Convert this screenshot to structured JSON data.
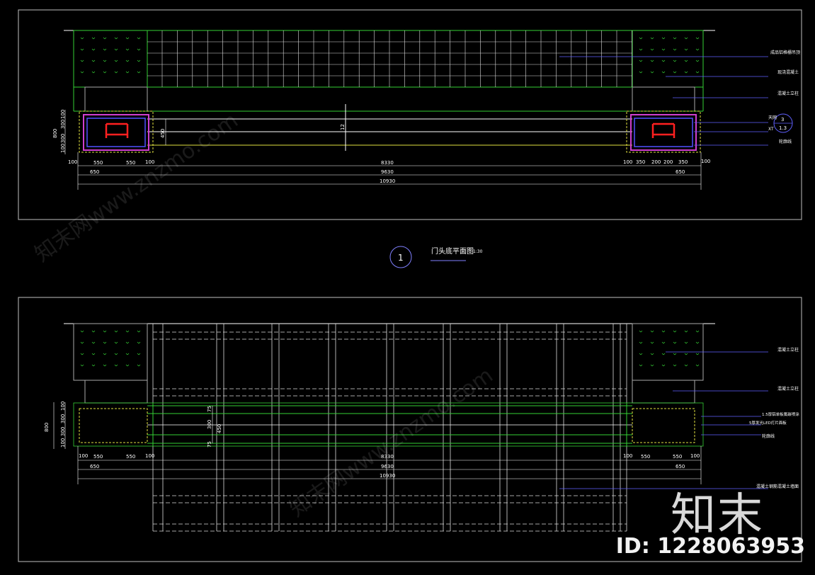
{
  "title": {
    "number": "1",
    "text": "门头底平面图",
    "scale": "1:30"
  },
  "top_plan": {
    "callouts": [
      "成品铝格栅吊顶",
      "现浇混凝土",
      "混凝土立柱",
      "天网",
      "XT",
      "轮廓线"
    ],
    "section_symbol": {
      "top": "3",
      "bottom": "1.3"
    },
    "dims_row1": [
      "100",
      "550",
      "550",
      "100",
      "8330",
      "100",
      "350",
      "200",
      "200",
      "350",
      "100"
    ],
    "dims_row2": [
      "650",
      "9630",
      "650"
    ],
    "dims_row3": [
      "10930"
    ],
    "vertical_dims": [
      "100",
      "300",
      "300",
      "100"
    ],
    "vertical_total": "800",
    "inner_dim": "450",
    "mid_label": "12"
  },
  "bottom_plan": {
    "callouts": [
      "混凝土立柱",
      "混凝土立柱",
      "1.5厚铝单板氟碳喷涂",
      "5厚发光LED灯片面板",
      "轮廓线",
      "混凝土钢筋混凝土墙面"
    ],
    "dims_row1": [
      "100",
      "550",
      "550",
      "100",
      "8330",
      "100",
      "550",
      "550",
      "100"
    ],
    "dims_row2": [
      "650",
      "9630",
      "650"
    ],
    "dims_row3": [
      "10930"
    ],
    "vertical_dims": [
      "100",
      "300",
      "300",
      "100"
    ],
    "vertical_total": "800",
    "inner_dims": [
      "75",
      "300",
      "450",
      "75"
    ]
  },
  "watermark": {
    "brand": "知末",
    "id_text": "ID: 1228063953",
    "text": "知末网www.znzmo.com"
  },
  "colors": {
    "background": "#000000",
    "line": "#ffffff",
    "green": "#35d035",
    "magenta": "#d040d0",
    "blue": "#5050ff",
    "red": "#ff2020",
    "yellow": "#e0e040"
  }
}
